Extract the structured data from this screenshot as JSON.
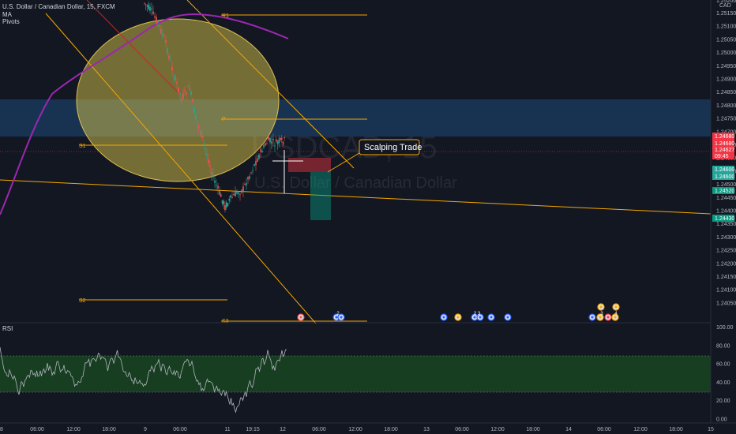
{
  "legend": {
    "symbol": "U.S. Dollar / Canadian Dollar, 15, FXCM",
    "ma_label": "MA",
    "pivots_label": "Pivots"
  },
  "watermark": {
    "ticker": "USDCAD, 15",
    "name": "U.S. Dollar / Canadian Dollar"
  },
  "annotation": {
    "callout_text": "Scalping Trade"
  },
  "currency": "CAD",
  "rsi": {
    "label": "RSI",
    "ticks": [
      "100.00",
      "80.00",
      "60.00",
      "40.00",
      "20.00",
      "0.00"
    ],
    "band": [
      30,
      70
    ]
  },
  "price_axis": {
    "ticks": [
      "1.25150",
      "1.25100",
      "1.25050",
      "1.25000",
      "1.24950",
      "1.24900",
      "1.24850",
      "1.24800",
      "1.24750",
      "1.24700",
      "1.24650",
      "1.24600",
      "1.24550",
      "1.24500",
      "1.24450",
      "1.24400",
      "1.24350",
      "1.24300",
      "1.24250",
      "1.24200",
      "1.24150",
      "1.24100",
      "1.24050"
    ],
    "top_partial": "1.25200",
    "markers": [
      {
        "text": "1.24680",
        "color": "#f23645"
      },
      {
        "text": "1.24680",
        "color": "#f23645"
      },
      {
        "text": "1.24627",
        "color": "#f23645"
      },
      {
        "text": "09:45",
        "color": "#f23645"
      },
      {
        "text": "1.24600",
        "color": "#26a69a"
      },
      {
        "text": "1.24600",
        "color": "#26a69a"
      },
      {
        "text": "1.24520",
        "color": "#089981"
      },
      {
        "text": "1.24430",
        "color": "#089981"
      }
    ]
  },
  "time_axis": {
    "labels": [
      "8",
      "06:00",
      "12:00",
      "18:00",
      "9",
      "06:00",
      "11",
      "19:15",
      "12",
      "06:00",
      "12:00",
      "18:00",
      "13",
      "06:00",
      "12:00",
      "18:00",
      "14",
      "06:00",
      "12:00",
      "18:00",
      "15"
    ]
  },
  "pivots": [
    "R1",
    "P",
    "S1",
    "S2",
    "S3"
  ],
  "events": {
    "groups": [
      "2",
      "2 3",
      "3",
      "4",
      "3",
      "3",
      "3",
      "3"
    ]
  },
  "colors": {
    "background": "#131722",
    "bull": "#26a69a",
    "bear": "#ef5350",
    "ma": "#9c27b0",
    "trendline": "#f7a600",
    "highlight": "#f7d046",
    "zone": "#1e4a7a",
    "rsi_line": "#b2b5be",
    "rsi_band": "#1b5e20"
  }
}
